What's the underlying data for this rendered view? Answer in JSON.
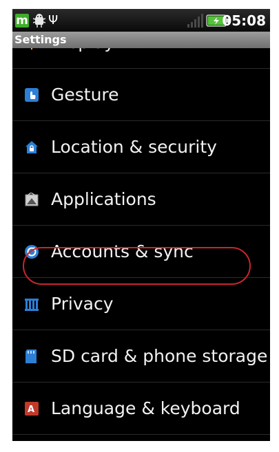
{
  "status_bar": {
    "time": "05:08",
    "app_badge": "m",
    "icons": [
      "app-m-icon",
      "android-debug-icon",
      "usb-icon",
      "signal-icon",
      "battery-charging-icon"
    ]
  },
  "title_bar": {
    "title": "Settings"
  },
  "settings": {
    "items": [
      {
        "label": "Display",
        "icon": "display-icon"
      },
      {
        "label": "Gesture",
        "icon": "gesture-icon"
      },
      {
        "label": "Location & security",
        "icon": "location-security-icon"
      },
      {
        "label": "Applications",
        "icon": "applications-icon"
      },
      {
        "label": "Accounts & sync",
        "icon": "accounts-sync-icon"
      },
      {
        "label": "Privacy",
        "icon": "privacy-icon"
      },
      {
        "label": "SD card & phone storage",
        "icon": "sd-card-icon"
      },
      {
        "label": "Language & keyboard",
        "icon": "language-keyboard-icon"
      }
    ]
  },
  "colors": {
    "highlight": "#c8262c",
    "background": "#000000",
    "title_bar": "#8a8a8a"
  }
}
